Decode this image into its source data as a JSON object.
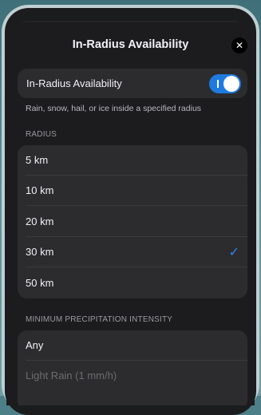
{
  "sheet": {
    "title": "In-Radius Availability",
    "close_icon": "close-icon"
  },
  "toggle_row": {
    "label": "In-Radius Availability",
    "enabled": true,
    "on_mark": "I"
  },
  "footnote": "Rain, snow, hail, or ice inside a specified radius",
  "radius": {
    "header": "RADIUS",
    "options": [
      "5 km",
      "10 km",
      "20 km",
      "30 km",
      "50 km"
    ],
    "selected": "30 km",
    "check_icon": "checkmark-icon"
  },
  "intensity": {
    "header": "MINIMUM PRECIPITATION INTENSITY",
    "options": [
      "Any",
      "Light Rain (1 mm/h)"
    ]
  },
  "colors": {
    "accent": "#1f7ae0",
    "checkmark": "#2f85f5",
    "card": "#2c2c2e",
    "sheet": "#1c1c1e"
  }
}
